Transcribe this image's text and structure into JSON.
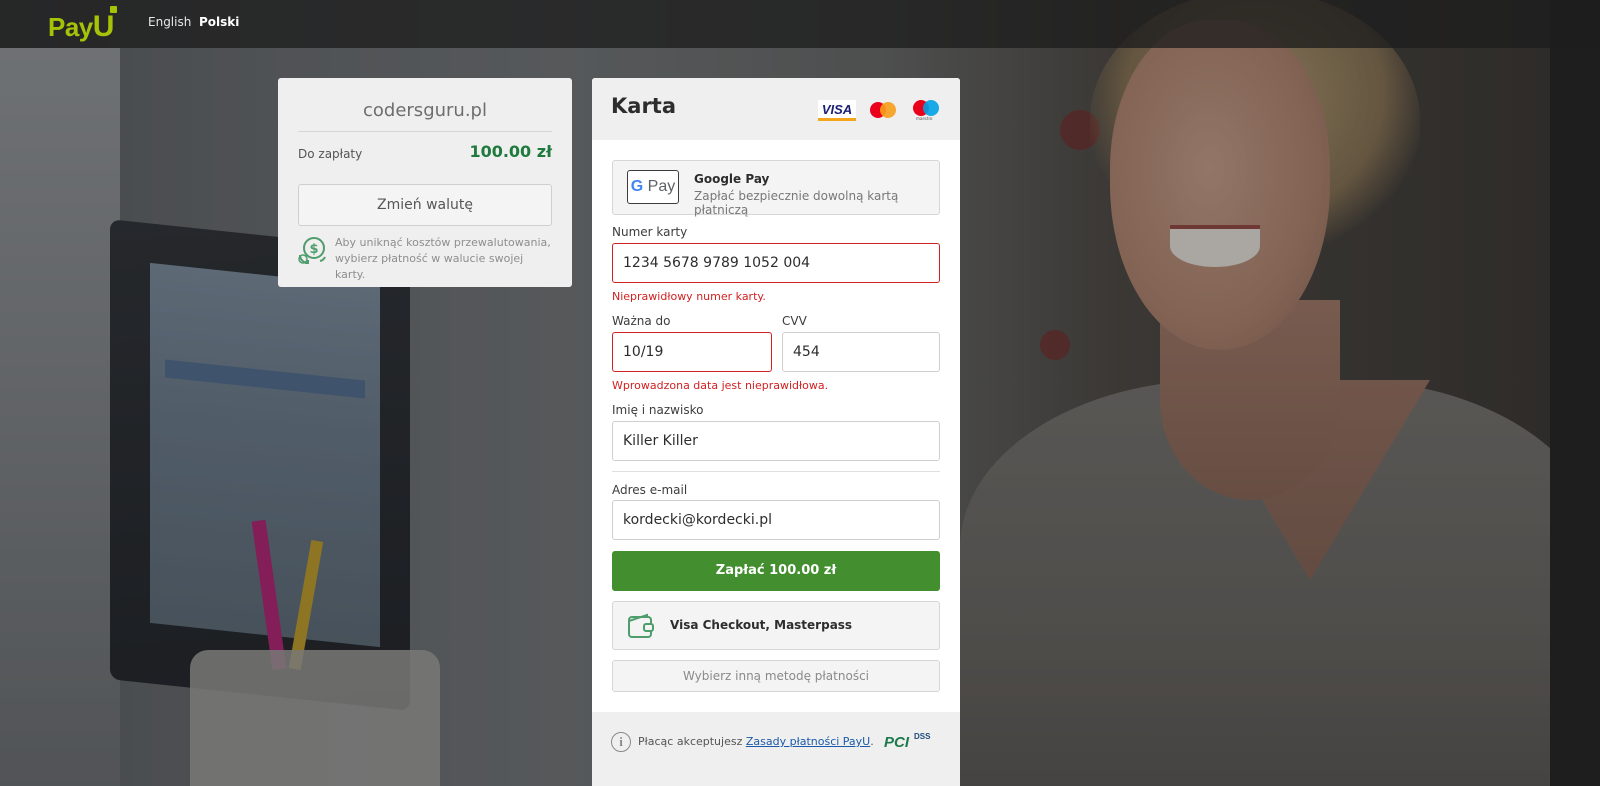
{
  "header": {
    "logo_pay": "Pay",
    "logo_u": "U",
    "languages": [
      {
        "label": "English",
        "active": false
      },
      {
        "label": "Polski",
        "active": true
      }
    ]
  },
  "summary": {
    "merchant": "codersguru.pl",
    "due_label": "Do zapłaty",
    "due_amount": "100.00 zł",
    "change_currency_label": "Zmień walutę",
    "fx_note": "Aby uniknąć kosztów przewalutowania, wybierz płatność w walucie swojej karty."
  },
  "card": {
    "title": "Karta",
    "brand_icons": [
      "visa-icon",
      "mastercard-icon",
      "maestro-icon"
    ],
    "visa_text": "VISA",
    "maestro_text": "maestro",
    "gpay": {
      "button_text_g": "G",
      "button_text_pay": " Pay",
      "title": "Google Pay",
      "subtitle": "Zapłać bezpiecznie dowolną kartą płatniczą"
    },
    "fields": {
      "card_number": {
        "label": "Numer karty",
        "value": "1234 5678 9789 1052 004",
        "error": "Nieprawidłowy numer karty."
      },
      "expiry": {
        "label": "Ważna do",
        "value": "10/19",
        "error": "Wprowadzona data jest nieprawidłowa."
      },
      "cvv": {
        "label": "CVV",
        "value": "454"
      },
      "name": {
        "label": "Imię i nazwisko",
        "value": "Killer Killer"
      },
      "email": {
        "label": "Adres e-mail",
        "value": "kordecki@kordecki.pl"
      }
    },
    "pay_button": "Zapłać 100.00 zł",
    "wallet_button": "Visa Checkout, Masterpass",
    "other_method_button": "Wybierz inną metodę płatności",
    "footer": {
      "terms_prefix": "Płacąc akceptujesz ",
      "terms_link": "Zasady płatności PayU",
      "terms_suffix": ".",
      "pci_text": "PCI",
      "dss_text": "DSS"
    }
  },
  "colors": {
    "brand_green": "#a6c307",
    "pay_button": "#438e2e",
    "amount": "#1f7a3e",
    "error": "#d22121",
    "link": "#1b5aa8"
  }
}
